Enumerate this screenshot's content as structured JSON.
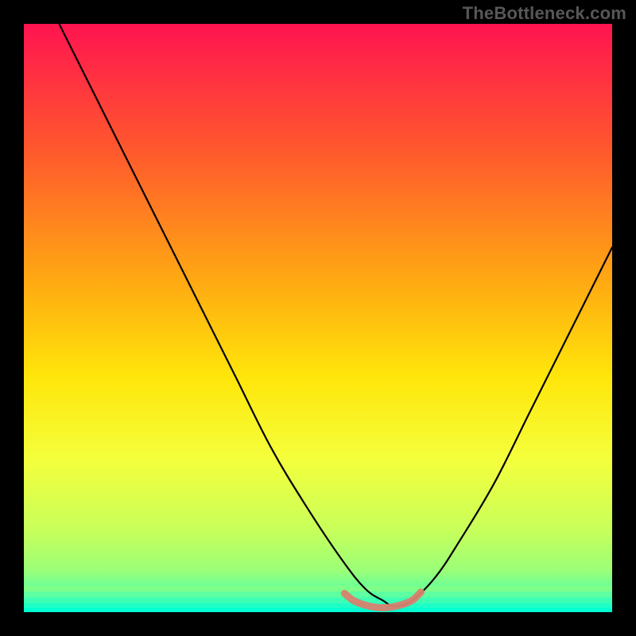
{
  "watermark": "TheBottleneck.com",
  "chart_data": {
    "type": "line",
    "title": "",
    "xlabel": "",
    "ylabel": "",
    "xlim": [
      0,
      100
    ],
    "ylim": [
      0,
      100
    ],
    "grid": false,
    "gradient_stops": [
      {
        "offset": 0.0,
        "color": "#ff1450"
      },
      {
        "offset": 0.22,
        "color": "#ff5a2c"
      },
      {
        "offset": 0.44,
        "color": "#ffaa12"
      },
      {
        "offset": 0.6,
        "color": "#ffe60a"
      },
      {
        "offset": 0.74,
        "color": "#f4ff3c"
      },
      {
        "offset": 0.86,
        "color": "#c8ff5a"
      },
      {
        "offset": 0.93,
        "color": "#9aff78"
      },
      {
        "offset": 0.965,
        "color": "#5effa0"
      },
      {
        "offset": 0.985,
        "color": "#28ffc2"
      },
      {
        "offset": 1.0,
        "color": "#00ffd0"
      }
    ],
    "bottom_bands": [
      {
        "y": 0.965,
        "color": "#7dff8a"
      },
      {
        "y": 0.975,
        "color": "#5effa0"
      },
      {
        "y": 0.985,
        "color": "#3cffb4"
      },
      {
        "y": 0.993,
        "color": "#1effc8"
      },
      {
        "y": 1.0,
        "color": "#00ffd0"
      }
    ],
    "series": [
      {
        "name": "curve",
        "color": "#000000",
        "stroke_width": 2.2,
        "x": [
          6,
          12,
          18,
          24,
          30,
          36,
          42,
          48,
          54,
          58,
          61,
          63,
          66,
          70,
          74,
          80,
          86,
          92,
          100
        ],
        "y": [
          100,
          88,
          76,
          64,
          52,
          40,
          28,
          18,
          9,
          4,
          2,
          1,
          2,
          6,
          12,
          22,
          34,
          46,
          62
        ]
      },
      {
        "name": "optimal-zone",
        "color": "#d9816f",
        "stroke_width": 9,
        "x": [
          54.5,
          56,
          58,
          60,
          62,
          64,
          66,
          67.5
        ],
        "y": [
          3.2,
          2.0,
          1.2,
          0.8,
          0.8,
          1.2,
          2.0,
          3.4
        ]
      }
    ]
  }
}
